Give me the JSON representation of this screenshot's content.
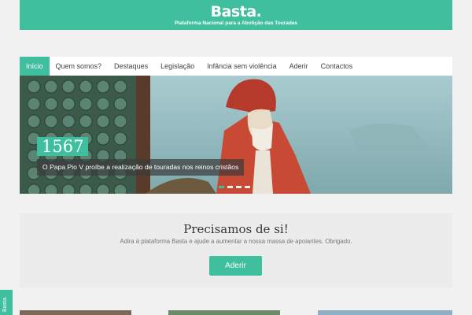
{
  "header": {
    "logo": "Basta.",
    "tagline": "Plataforma Nacional para a Abolição das Touradas",
    "brand_color": "#3fbf9d"
  },
  "nav": {
    "items": [
      {
        "label": "Início",
        "active": true
      },
      {
        "label": "Quem somos?"
      },
      {
        "label": "Destaques"
      },
      {
        "label": "Legislação"
      },
      {
        "label": "Infância sem violência"
      },
      {
        "label": "Aderir"
      },
      {
        "label": "Contactos"
      }
    ]
  },
  "hero": {
    "year": "1567",
    "caption": "O Papa Pio V proíbe a realização de touradas nos reinos cristãos",
    "slides": 4,
    "active_slide": 0
  },
  "cta": {
    "title": "Precisamos de si!",
    "subtitle": "Adira à plataforma Basta e ajude a aumentar a nossa massa de apoiantes. Obrigado.",
    "button": "Aderir"
  },
  "side_tab": {
    "label": "Basta."
  }
}
